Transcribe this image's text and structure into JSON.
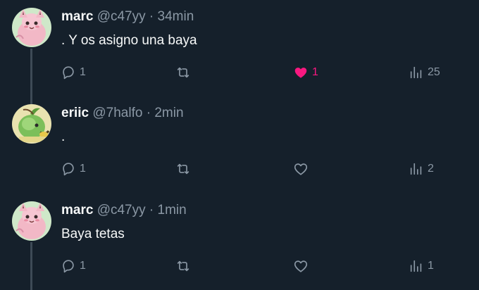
{
  "tweets": [
    {
      "name": "marc",
      "handle": "@c47yy",
      "sep": " · ",
      "time": "34min",
      "text": ". Y os asigno una baya",
      "avatar": "clefairy-avatar",
      "replies": "1",
      "retweets": "",
      "likes": "1",
      "liked": true,
      "views": "25"
    },
    {
      "name": "eriic",
      "handle": "@7halfo",
      "sep": " · ",
      "time": "2min",
      "text": ".",
      "avatar": "green-creature-avatar",
      "replies": "1",
      "retweets": "",
      "likes": "",
      "liked": false,
      "views": "2"
    },
    {
      "name": "marc",
      "handle": "@c47yy",
      "sep": " · ",
      "time": "1min",
      "text": "Baya tetas",
      "avatar": "clefairy-avatar",
      "replies": "1",
      "retweets": "",
      "likes": "",
      "liked": false,
      "views": "1"
    }
  ],
  "colors": {
    "background": "#15202b",
    "secondary_text": "#8b98a5",
    "like_active": "#f91880",
    "thread_line": "#3d4a56"
  }
}
